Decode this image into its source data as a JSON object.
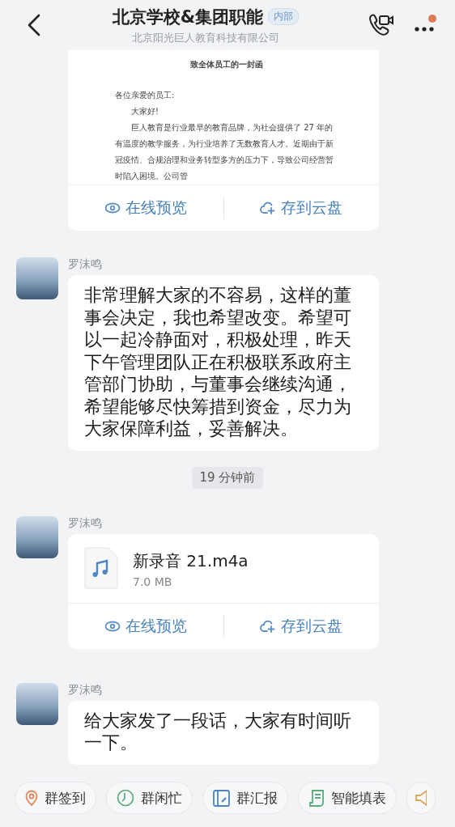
{
  "header": {
    "title": "北京学校&集团职能",
    "badge": "内部",
    "subtitle": "北京阳光巨人教育科技有限公司",
    "has_unread": true
  },
  "messages": [
    {
      "kind": "document",
      "doc_title": "致全体员工的一封函",
      "doc_lines": [
        {
          "text": "各位亲爱的员工:",
          "indent": false
        },
        {
          "text": "大家好!",
          "indent": true
        },
        {
          "text": "巨人教育是行业最早的教育品牌，为社会提供了 27 年的有温度的教学服务，为行业培养了无数教育人才。近期由于新冠疫情、合规治理和业务转型多方的压力下，导致公司经营暂时陷入困境。公司管",
          "indent": true
        }
      ],
      "actions": [
        "在线预览",
        "存到云盘"
      ]
    },
    {
      "kind": "text",
      "sender": "罗沫鸣",
      "text": "非常理解大家的不容易，这样的董事会决定，我也希望改变。希望可以一起冷静面对，积极处理，昨天下午管理团队正在积极联系政府主管部门协助，与董事会继续沟通，希望能够尽快筹措到资金，尽力为大家保障利益，妥善解决。"
    },
    {
      "kind": "time",
      "text": "19 分钟前"
    },
    {
      "kind": "file",
      "sender": "罗沫鸣",
      "file_name": "新录音 21.m4a",
      "file_size": "7.0 MB",
      "actions": [
        "在线预览",
        "存到云盘"
      ]
    },
    {
      "kind": "text",
      "sender": "罗沫鸣",
      "text": "给大家发了一段话，大家有时间听一下。"
    }
  ],
  "toolbar": [
    {
      "kind": "checkin",
      "label": "群签到"
    },
    {
      "kind": "busy",
      "label": "群闲忙"
    },
    {
      "kind": "report",
      "label": "群汇报"
    },
    {
      "kind": "form",
      "label": "智能填表"
    },
    {
      "kind": "announce"
    }
  ]
}
